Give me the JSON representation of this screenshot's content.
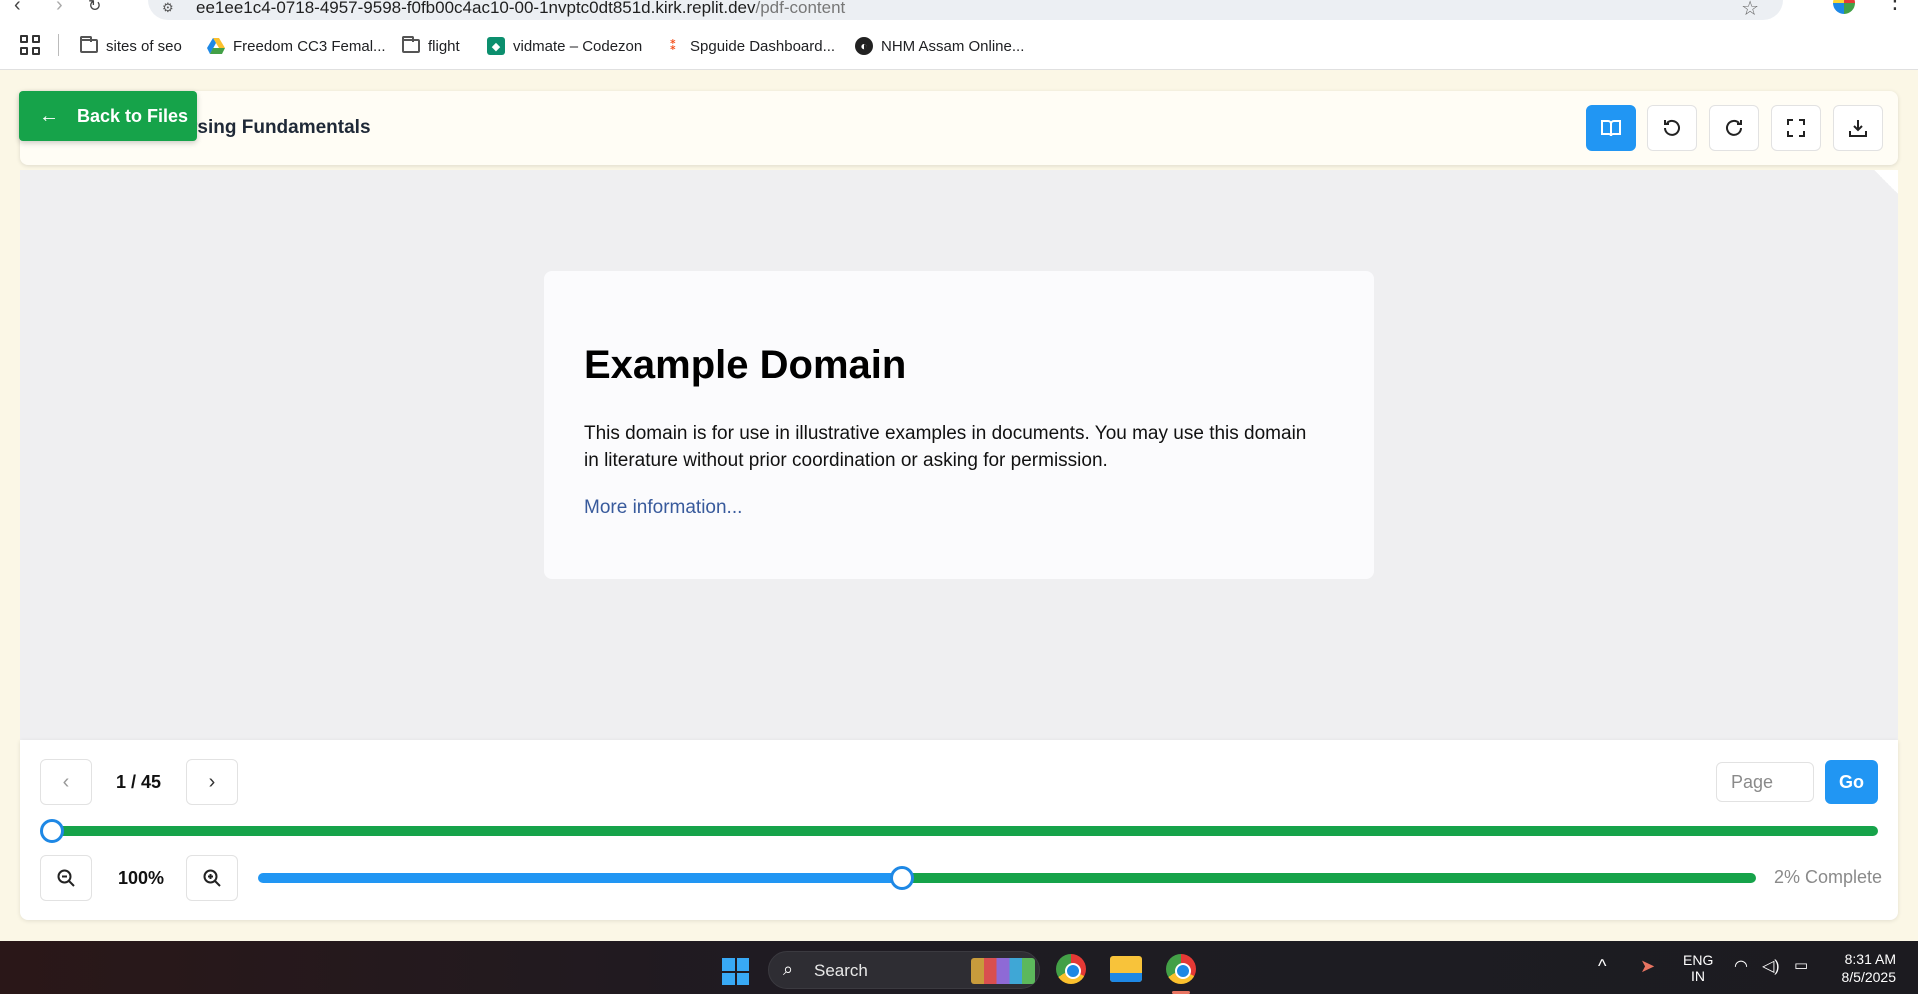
{
  "browser": {
    "url_host": "ee1ee1c4-0718-4957-9598-f0fb00c4ac10-00-1nvptc0dt851d.kirk.replit.dev",
    "url_path": "/pdf-content",
    "bookmarks": [
      {
        "label": "sites of seo",
        "icon": "folder-icon"
      },
      {
        "label": "Freedom CC3 Femal...",
        "icon": "google-drive-icon"
      },
      {
        "label": "flight",
        "icon": "folder-icon"
      },
      {
        "label": "vidmate – Codezon",
        "icon": "vidmate-icon"
      },
      {
        "label": "Spguide Dashboard...",
        "icon": "spguide-icon"
      },
      {
        "label": "NHM Assam Online...",
        "icon": "globe-icon"
      }
    ]
  },
  "header": {
    "title": "rsing Fundamentals",
    "back_label": "Back to Files",
    "tools": [
      "book-icon",
      "rotate-left-icon",
      "rotate-right-icon",
      "fullscreen-icon",
      "download-icon"
    ]
  },
  "page": {
    "heading": "Example Domain",
    "body": "This domain is for use in illustrative examples in documents. You may use this domain in literature without prior coordination or asking for permission.",
    "link": "More information..."
  },
  "controls": {
    "page_indicator": "1 / 45",
    "page_placeholder": "Page",
    "go_label": "Go",
    "zoom_level": "100%",
    "progress_label": "2% Complete",
    "page_slider_fraction": 0.02,
    "zoom_slider_fraction": 0.43
  },
  "taskbar": {
    "search_label": "Search",
    "lang_line1": "ENG",
    "lang_line2": "IN",
    "time": "8:31 AM",
    "date": "8/5/2025"
  },
  "colors": {
    "accent_blue": "#2196f3",
    "accent_green": "#16a34a"
  }
}
